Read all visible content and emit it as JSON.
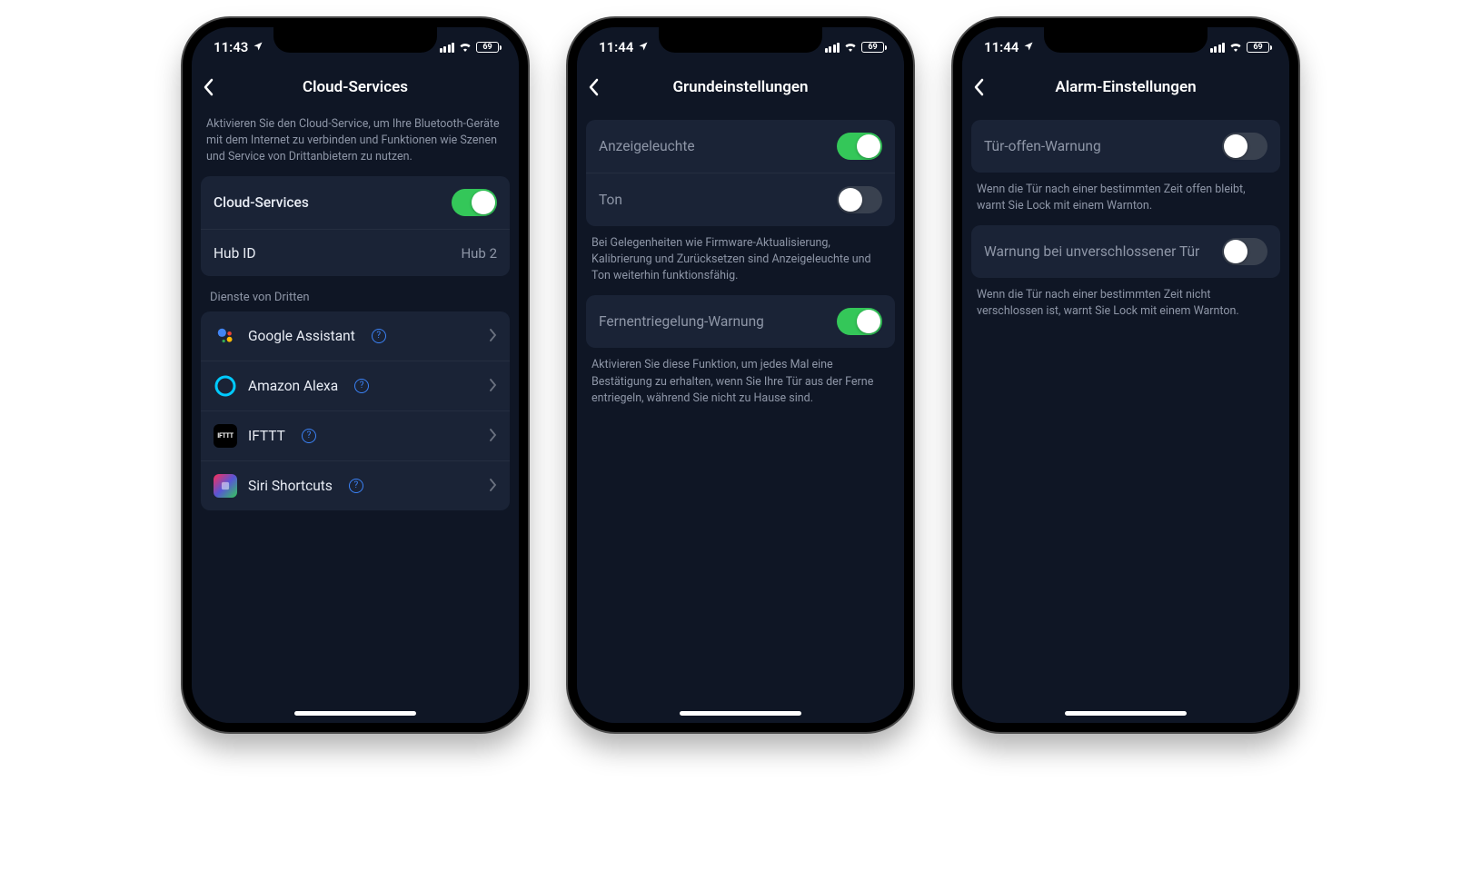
{
  "status": {
    "battery": "69"
  },
  "screens": [
    {
      "time": "11:43",
      "title": "Cloud-Services",
      "intro": "Aktivieren Sie den Cloud-Service, um Ihre Bluetooth-Geräte mit dem Internet zu verbinden und Funktionen wie Szenen und Service von Drittanbietern zu nutzen.",
      "cloud_row": {
        "label": "Cloud-Services",
        "on": true
      },
      "hub_row": {
        "label": "Hub ID",
        "value": "Hub 2"
      },
      "third_party_header": "Dienste von Dritten",
      "services": [
        {
          "key": "google-assistant",
          "label": "Google Assistant"
        },
        {
          "key": "amazon-alexa",
          "label": "Amazon Alexa"
        },
        {
          "key": "ifttt",
          "label": "IFTTT"
        },
        {
          "key": "siri-shortcuts",
          "label": "Siri Shortcuts"
        }
      ]
    },
    {
      "time": "11:44",
      "title": "Grundeinstellungen",
      "rows1": [
        {
          "key": "indicator-light",
          "label": "Anzeigeleuchte",
          "on": true
        },
        {
          "key": "sound",
          "label": "Ton",
          "on": false
        }
      ],
      "note1": "Bei Gelegenheiten wie Firmware-Aktualisierung, Kalibrierung und Zurücksetzen sind Anzeigeleuchte und Ton weiterhin funktionsfähig.",
      "row2": {
        "key": "remote-unlock-warning",
        "label": "Fernentriegelung-Warnung",
        "on": true
      },
      "note2": "Aktivieren Sie diese Funktion, um jedes Mal eine Bestätigung zu erhalten, wenn Sie Ihre Tür aus der Ferne entriegeln, während Sie nicht zu Hause sind."
    },
    {
      "time": "11:44",
      "title": "Alarm-Einstellungen",
      "row1": {
        "key": "door-open-warning",
        "label": "Tür-offen-Warnung",
        "on": false
      },
      "note1": "Wenn die Tür nach einer bestimmten Zeit offen bleibt, warnt Sie Lock mit einem Warnton.",
      "row2": {
        "key": "unlocked-door-warning",
        "label": "Warnung bei unverschlossener Tür",
        "on": false
      },
      "note2": "Wenn die Tür nach einer bestimmten Zeit nicht verschlossen ist, warnt Sie Lock mit einem Warnton."
    }
  ]
}
